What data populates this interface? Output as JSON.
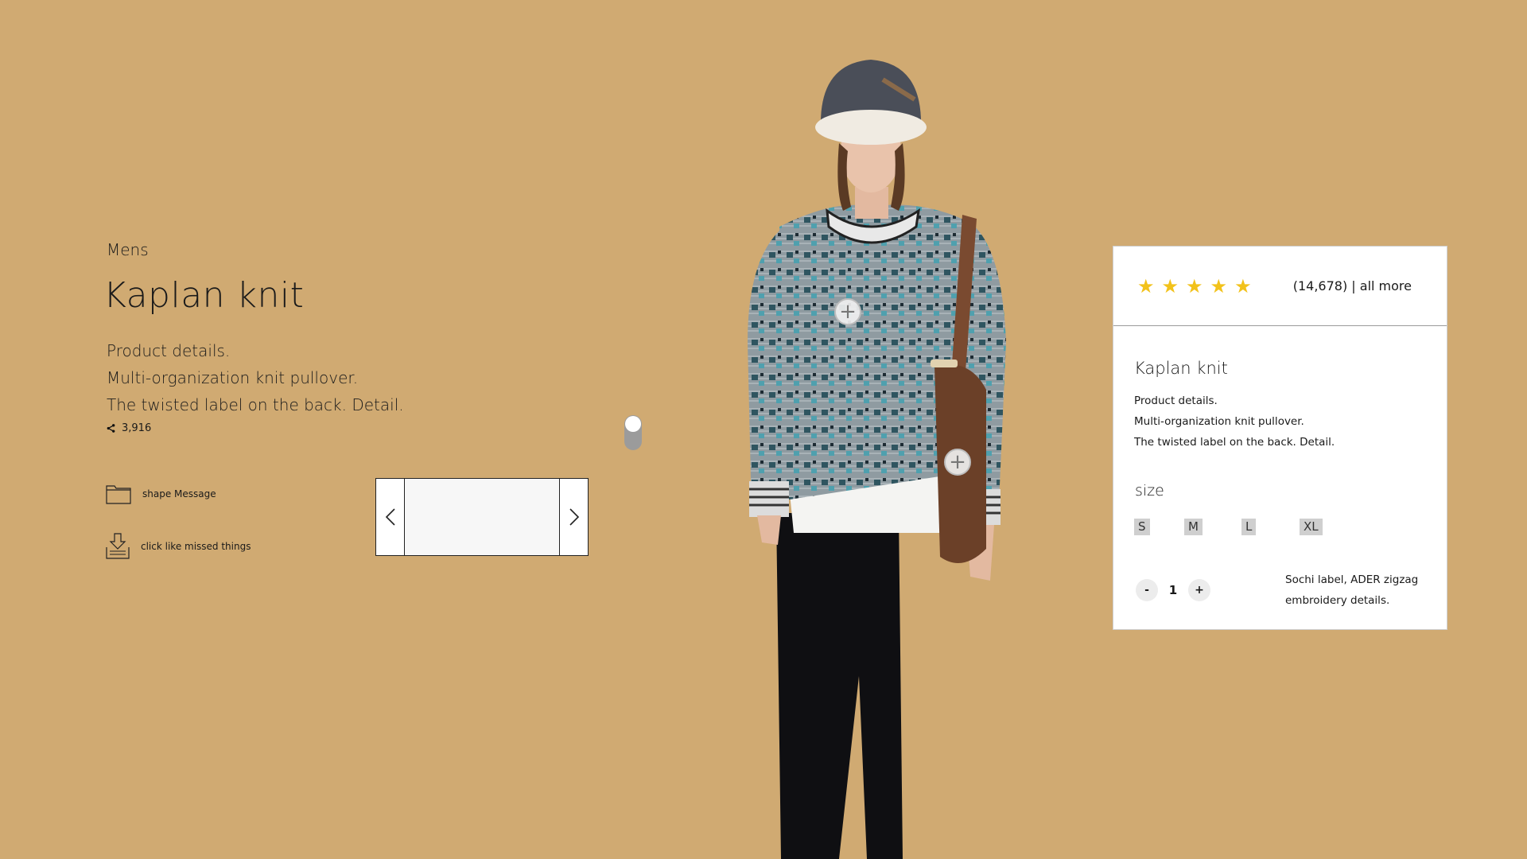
{
  "left": {
    "category": "Mens",
    "title": "Kaplan knit",
    "description": [
      "Product details.",
      "Multi-organization knit pullover.",
      "The twisted label on the back. Detail."
    ],
    "share_count": "3,916",
    "actions": {
      "message_label": "shape Message",
      "wishlist_label": "click like missed things"
    }
  },
  "card": {
    "rating_stars": 5,
    "reviews": "(14,678)  | all more",
    "title": "Kaplan knit",
    "description": [
      "Product details.",
      "Multi-organization knit pullover.",
      "The twisted label on the back. Detail."
    ],
    "size_label": "size",
    "sizes": [
      "S",
      "M",
      "L",
      "XL"
    ],
    "quantity": {
      "minus": "-",
      "value": "1",
      "plus": "+"
    },
    "note": "Sochi label, ADER zigzag embroidery details."
  },
  "colors": {
    "background": "#d0aa72",
    "star": "#f2c21b"
  },
  "icons": [
    "share-icon",
    "folder-icon",
    "download-tray-icon",
    "chevron-left-icon",
    "chevron-right-icon",
    "plus-icon",
    "star-icon"
  ]
}
